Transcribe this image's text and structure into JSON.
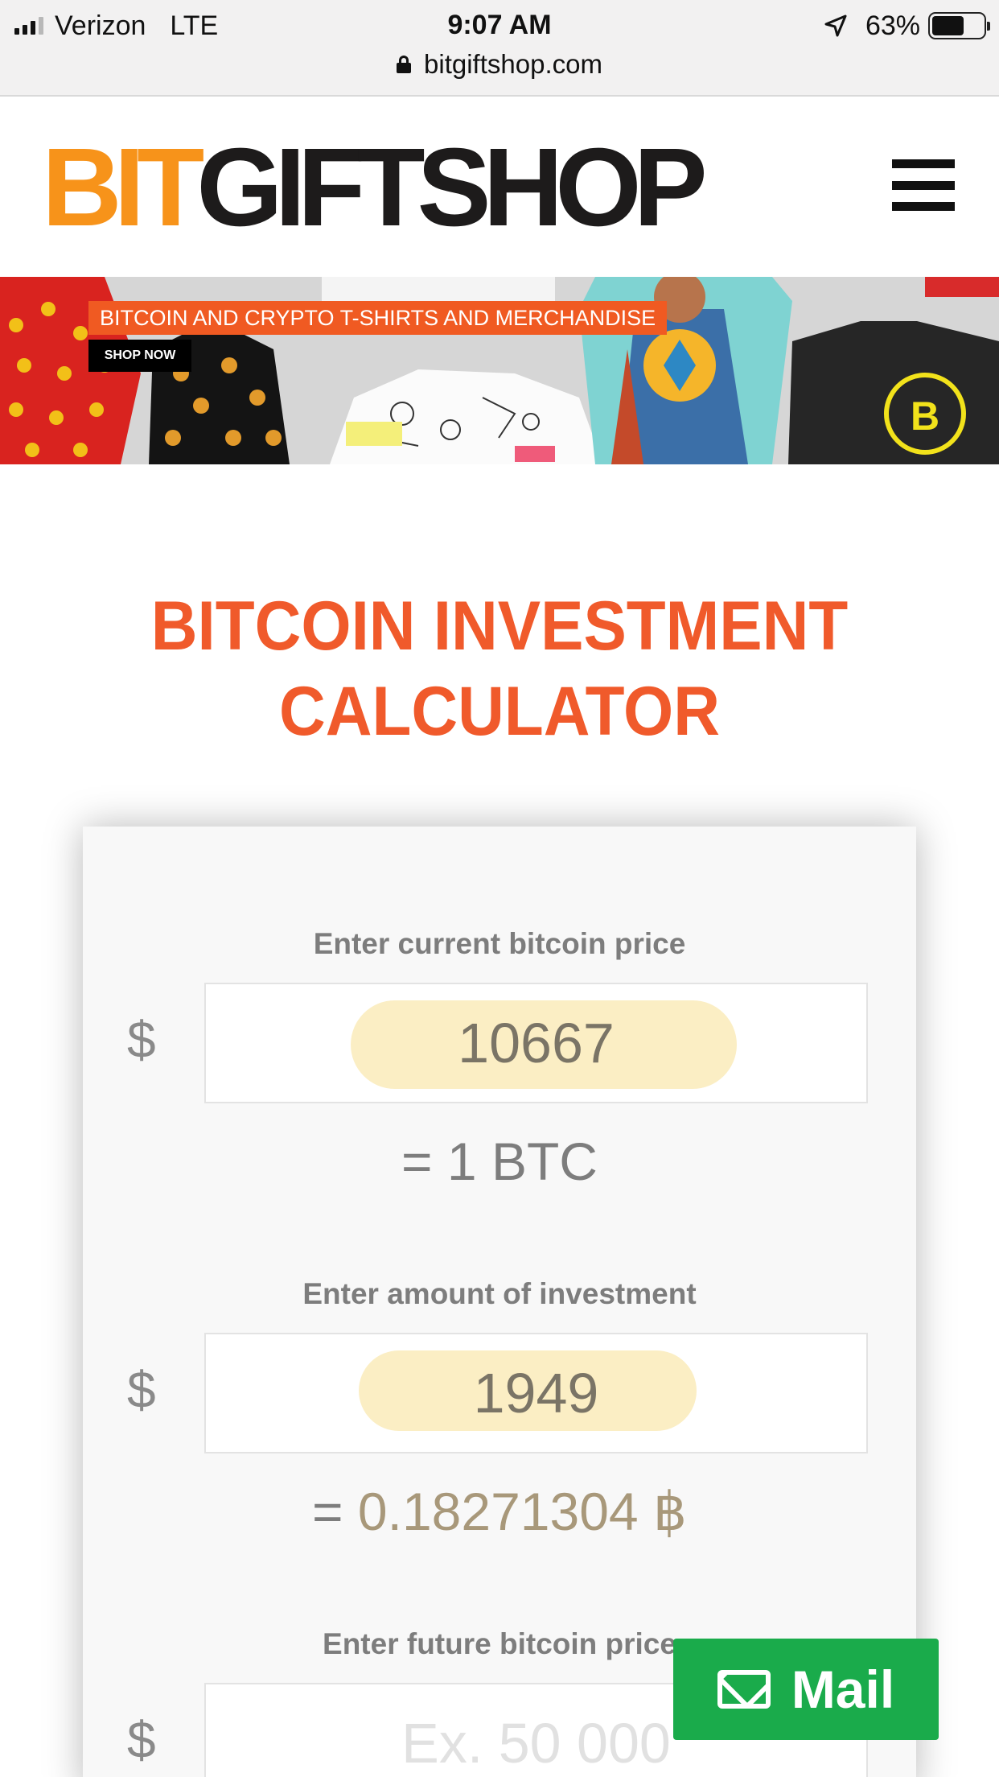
{
  "status_bar": {
    "carrier": "Verizon",
    "network": "LTE",
    "time": "9:07 AM",
    "battery": "63%",
    "battery_level": 0.63,
    "url": "bitgiftshop.com"
  },
  "header": {
    "logo_bit": "BIT",
    "logo_rest": "GIFTSHOP",
    "menu_icon": "hamburger-menu-icon"
  },
  "banner": {
    "title": "BITCOIN AND CRYPTO T-SHIRTS AND MERCHANDISE",
    "cta": "SHOP NOW"
  },
  "page": {
    "title_line1": "BITCOIN INVESTMENT",
    "title_line2": "CALCULATOR"
  },
  "calculator": {
    "currency_symbol": "$",
    "current_price": {
      "label": "Enter current bitcoin price",
      "value": "10667",
      "result": "= 1 BTC"
    },
    "investment": {
      "label": "Enter amount of investment",
      "value": "1949",
      "result_prefix": "=",
      "result_value": "0.18271304 ฿"
    },
    "future_price": {
      "label": "Enter future bitcoin price",
      "placeholder": "Ex. 50 000"
    }
  },
  "mail_button": {
    "label": "Mail",
    "icon": "envelope-icon"
  },
  "colors": {
    "brand_orange": "#f7931a",
    "title_red": "#f05a2b",
    "mail_green": "#1aab4b",
    "highlight": "#fbeec4"
  }
}
